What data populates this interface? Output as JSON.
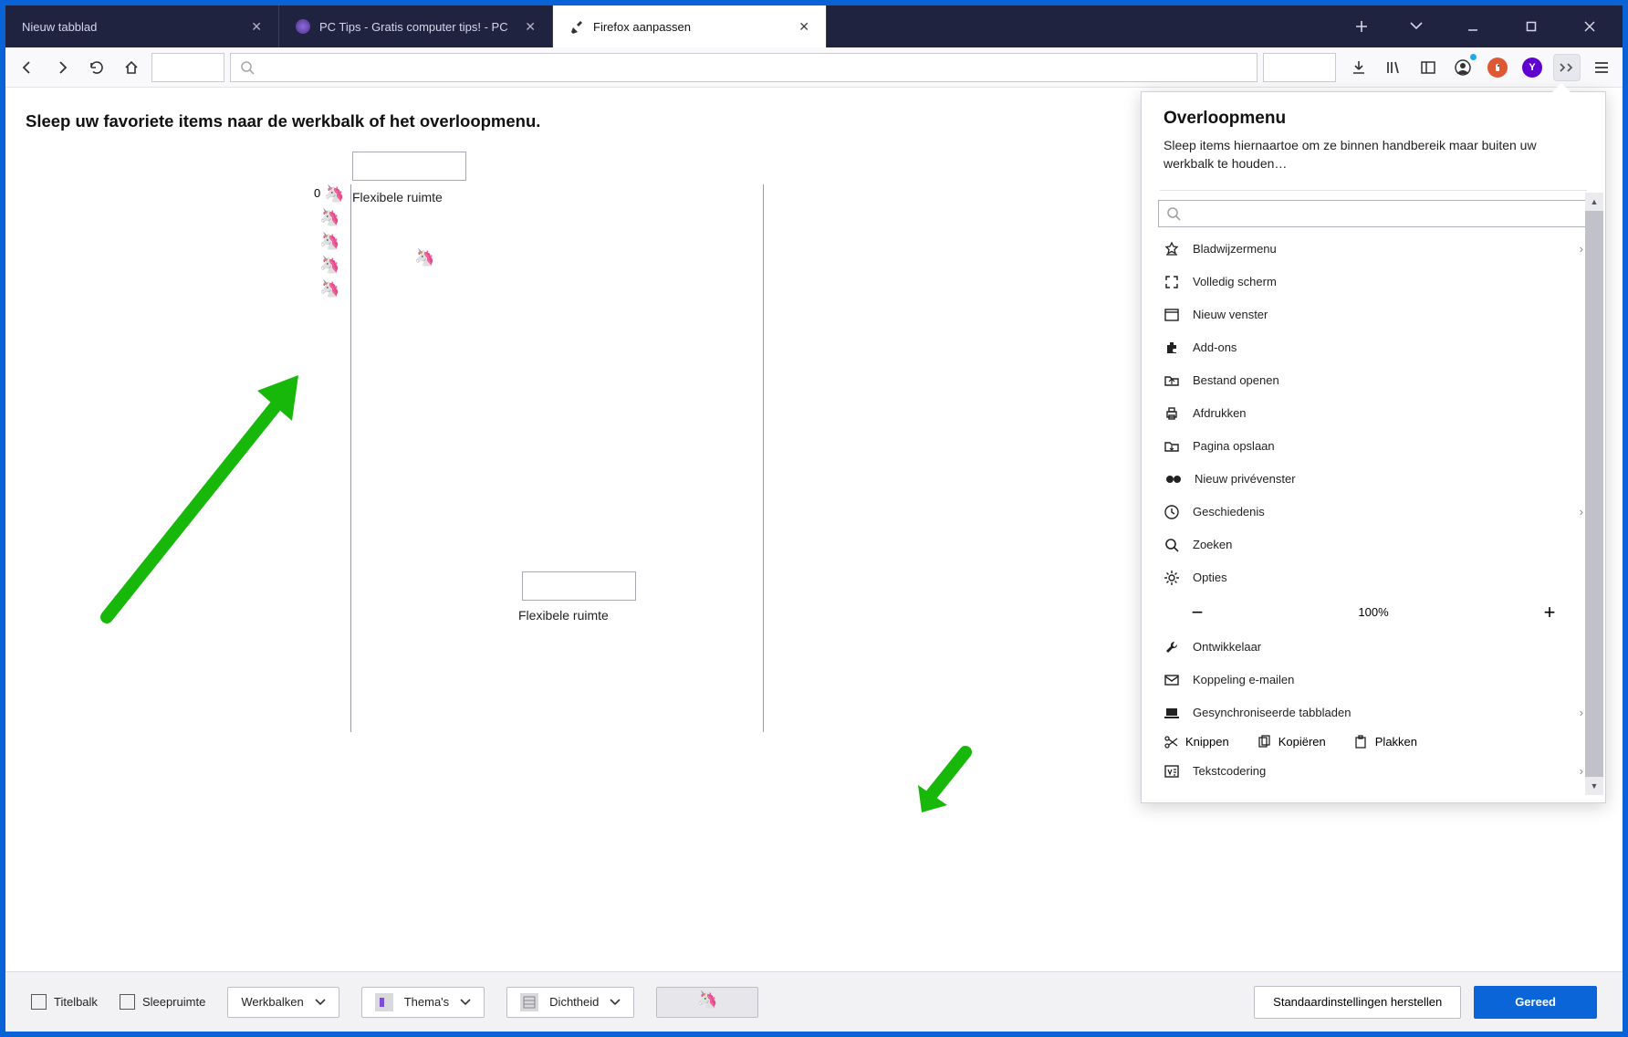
{
  "tabs": [
    {
      "title": "Nieuw tabblad"
    },
    {
      "title": "PC Tips - Gratis computer tips! - PC"
    },
    {
      "title": "Firefox aanpassen"
    }
  ],
  "heading": "Sleep uw favoriete items naar de werkbalk of het overloopmenu.",
  "flex1_label": "Flexibele ruimte",
  "flex2_label": "Flexibele ruimte",
  "overflow": {
    "title": "Overloopmenu",
    "subtitle": "Sleep items hiernaartoe om ze binnen handbereik maar buiten uw werkbalk te houden…",
    "items": [
      {
        "icon": "bookmark",
        "label": "Bladwijzermenu",
        "chev": true
      },
      {
        "icon": "fullscreen",
        "label": "Volledig scherm"
      },
      {
        "icon": "window",
        "label": "Nieuw venster"
      },
      {
        "icon": "addons",
        "label": "Add-ons"
      },
      {
        "icon": "open",
        "label": "Bestand openen"
      },
      {
        "icon": "print",
        "label": "Afdrukken"
      },
      {
        "icon": "save",
        "label": "Pagina opslaan"
      },
      {
        "icon": "private",
        "label": "Nieuw privévenster"
      },
      {
        "icon": "history",
        "label": "Geschiedenis",
        "chev": true
      },
      {
        "icon": "search",
        "label": "Zoeken"
      },
      {
        "icon": "options",
        "label": "Opties"
      }
    ],
    "zoom_level": "100%",
    "items2": [
      {
        "icon": "dev",
        "label": "Ontwikkelaar"
      },
      {
        "icon": "mail",
        "label": "Koppeling e-mailen"
      },
      {
        "icon": "sync",
        "label": "Gesynchroniseerde tabbladen",
        "chev": true
      }
    ],
    "cut": {
      "cut": "Knippen",
      "copy": "Kopiëren",
      "paste": "Plakken"
    },
    "encoding": {
      "label": "Tekstcodering"
    }
  },
  "footer": {
    "titlebar": "Titelbalk",
    "dragspace": "Sleepruimte",
    "toolbars": "Werkbalken",
    "themes": "Thema's",
    "density": "Dichtheid",
    "restore": "Standaardinstellingen herstellen",
    "done": "Gereed"
  }
}
